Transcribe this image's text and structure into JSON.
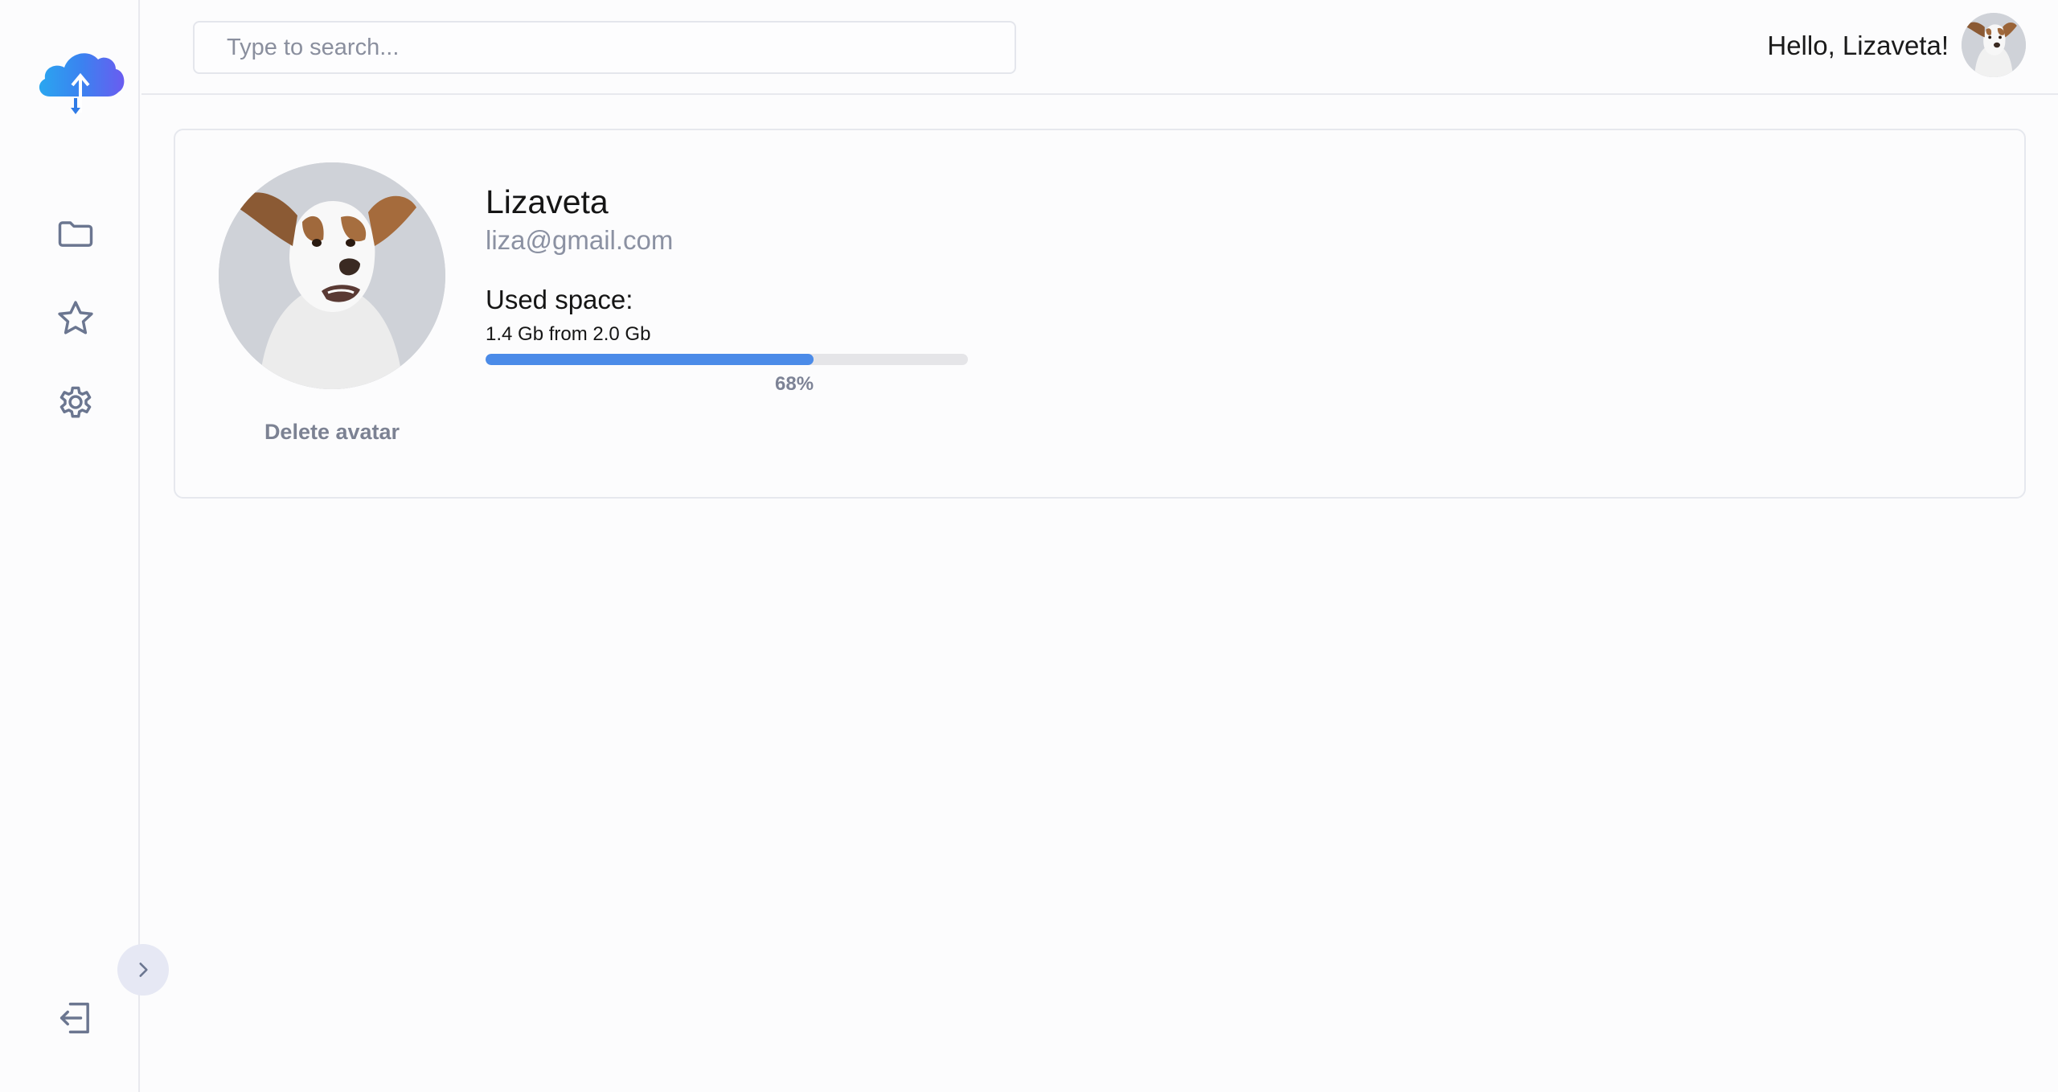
{
  "search": {
    "placeholder": "Type to search..."
  },
  "header": {
    "greeting": "Hello, Lizaveta!"
  },
  "sidebar": {
    "items": [
      {
        "icon": "folder-icon"
      },
      {
        "icon": "star-icon"
      },
      {
        "icon": "gear-icon"
      },
      {
        "icon": "logout-icon"
      }
    ],
    "expand_icon": "chevron-right-icon"
  },
  "profile": {
    "name": "Lizaveta",
    "email": "liza@gmail.com",
    "delete_avatar_label": "Delete avatar",
    "used_space_title": "Used space:",
    "used_space_detail": "1.4 Gb from 2.0 Gb",
    "usage_percent": 68,
    "usage_label": "68%"
  },
  "colors": {
    "accent": "#4b8be8",
    "icon": "#6b7690",
    "text_muted": "#8b91a2"
  }
}
